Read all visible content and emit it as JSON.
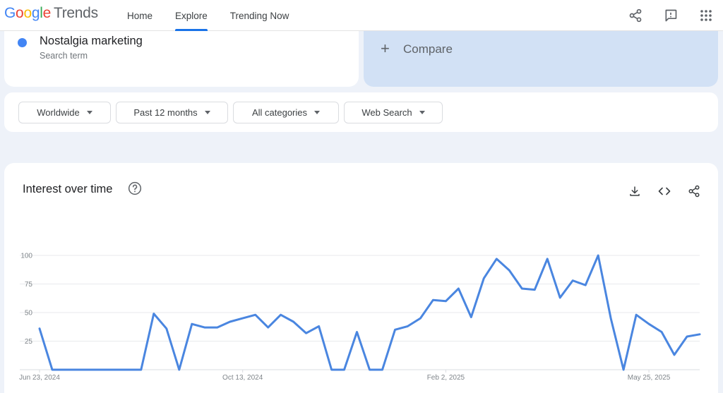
{
  "header": {
    "logo": {
      "google": "Google",
      "trends": "Trends"
    },
    "nav": [
      {
        "label": "Home"
      },
      {
        "label": "Explore"
      },
      {
        "label": "Trending Now"
      }
    ],
    "icons": [
      "share-icon",
      "feedback-icon",
      "apps-grid-icon"
    ]
  },
  "search_term": {
    "name": "Nostalgia marketing",
    "subtitle": "Search term",
    "color": "#4285f4"
  },
  "compare": {
    "label": "Compare"
  },
  "filters": [
    {
      "label": "Worldwide"
    },
    {
      "label": "Past 12 months"
    },
    {
      "label": "All categories"
    },
    {
      "label": "Web Search"
    }
  ],
  "chart_section": {
    "title": "Interest over time",
    "actions": [
      "download-icon",
      "embed-icon",
      "share-icon"
    ]
  },
  "chart_data": {
    "type": "line",
    "title": "Interest over time",
    "xlabel": "",
    "ylabel": "",
    "ylim": [
      0,
      100
    ],
    "yticks": [
      25,
      50,
      75,
      100
    ],
    "grid": true,
    "x_tick_labels": [
      {
        "label": "Jun 23, 2024",
        "index": 0
      },
      {
        "label": "Oct 13, 2024",
        "index": 16
      },
      {
        "label": "Feb 2, 2025",
        "index": 32
      },
      {
        "label": "May 25, 2025",
        "index": 48
      }
    ],
    "series": [
      {
        "color": "#4a86e0",
        "values": [
          36,
          0,
          0,
          0,
          0,
          0,
          0,
          0,
          0,
          49,
          36,
          0,
          40,
          37,
          37,
          42,
          45,
          48,
          37,
          48,
          42,
          32,
          38,
          0,
          0,
          33,
          0,
          0,
          35,
          38,
          45,
          61,
          60,
          71,
          46,
          80,
          97,
          87,
          71,
          70,
          97,
          63,
          78,
          74,
          100,
          45,
          0,
          48,
          40,
          33,
          13,
          29,
          31
        ]
      }
    ]
  }
}
